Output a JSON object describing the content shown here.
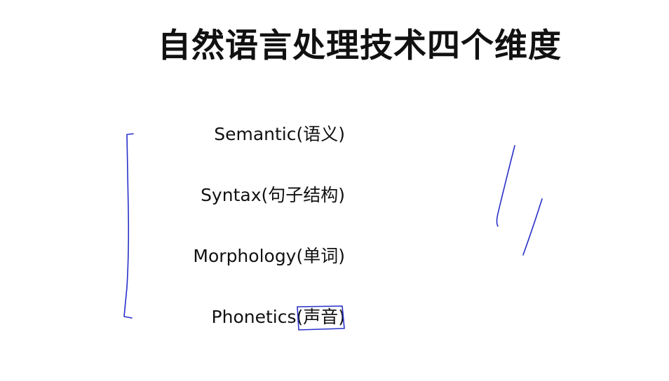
{
  "slide": {
    "title": "自然语言处理技术四个维度"
  },
  "dimensions": [
    {
      "label": "Semantic(语义)"
    },
    {
      "label": "Syntax(句子结构)"
    },
    {
      "label": "Morphology(单词)"
    },
    {
      "label": "Phonetics(声音)"
    }
  ],
  "annotation_color": "#2830c8"
}
